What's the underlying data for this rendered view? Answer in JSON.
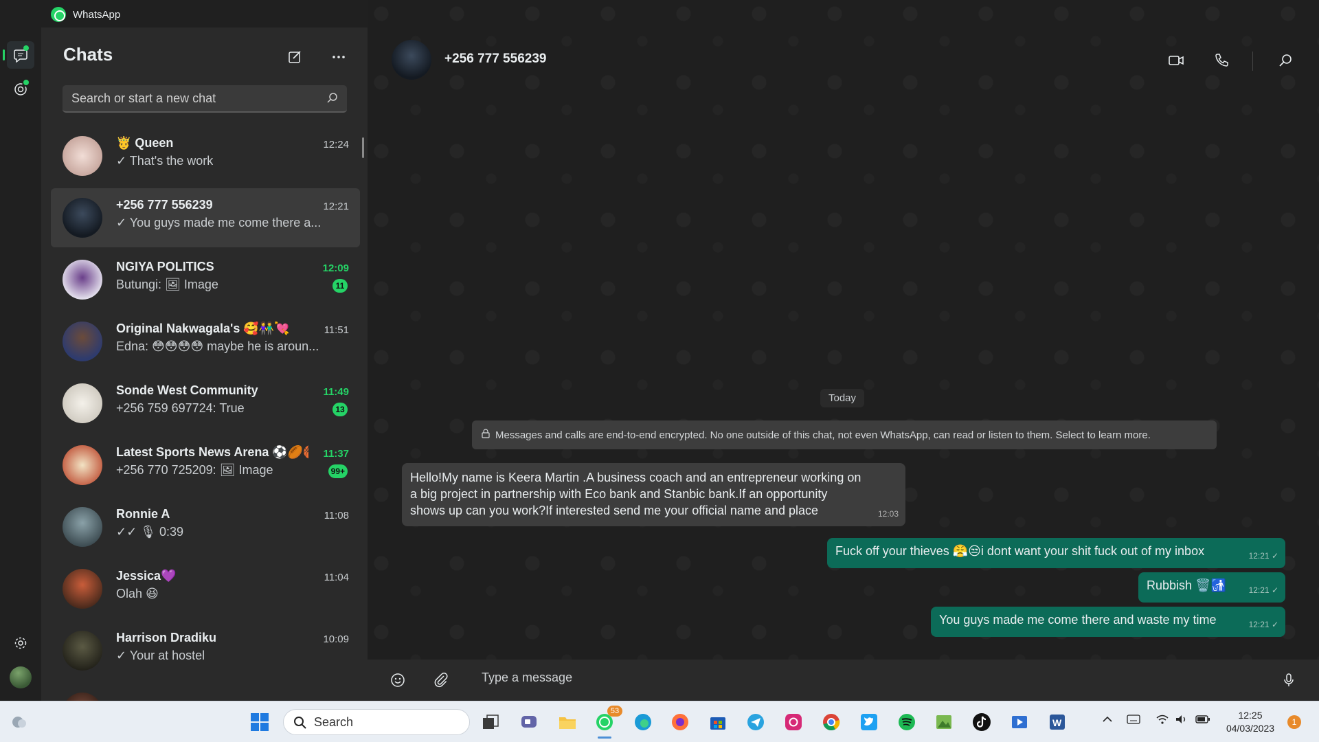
{
  "window": {
    "app_title": "WhatsApp"
  },
  "chatlist": {
    "title": "Chats",
    "search_placeholder": "Search or start a new chat",
    "items": [
      {
        "name": "🤴 Queen",
        "preview": "✓ That's the work",
        "time": "12:24",
        "badge": "",
        "selected": false
      },
      {
        "name": "+256 777 556239",
        "preview": "✓ You guys made me come there a...",
        "time": "12:21",
        "badge": "",
        "selected": true
      },
      {
        "name": "NGIYA POLITICS",
        "preview": "Butungi: 🖼 Image",
        "time": "12:09",
        "badge": "11",
        "selected": false
      },
      {
        "name": "Original Nakwagala's 🥰👫💘",
        "preview": "Edna: 😳😳😳😳 maybe he is aroun...",
        "time": "11:51",
        "badge": "",
        "selected": false
      },
      {
        "name": "Sonde West Community",
        "preview": "+256 759 697724: True",
        "time": "11:49",
        "badge": "13",
        "selected": false
      },
      {
        "name": "Latest Sports News Arena ⚽🏉🏀",
        "preview": "+256 770 725209: 🖼 Image",
        "time": "11:37",
        "badge": "99+",
        "selected": false
      },
      {
        "name": "Ronnie A",
        "preview": "✓✓ 🎙 0:39",
        "time": "11:08",
        "badge": "",
        "selected": false
      },
      {
        "name": "Jessica💜",
        "preview": "Olah 😆",
        "time": "11:04",
        "badge": "",
        "selected": false
      },
      {
        "name": "Harrison Dradiku",
        "preview": "✓ Your at hostel",
        "time": "10:09",
        "badge": "",
        "selected": false
      }
    ]
  },
  "conversation": {
    "contact": "+256 777 556239",
    "date_chip": "Today",
    "encryption_notice": "Messages and calls are end-to-end encrypted. No one outside of this chat, not even WhatsApp, can read or listen to them. Select to learn more.",
    "messages": [
      {
        "direction": "in",
        "text": "Hello!My name is Keera Martin .A business coach and an entrepreneur  working on a big project in partnership with Eco bank and Stanbic bank.If an opportunity shows up can you work?If interested send me your official name and place",
        "time": "12:03"
      },
      {
        "direction": "out",
        "text": "Fuck off your thieves 😤😒i dont want your shit fuck out of my inbox",
        "time": "12:21 ✓"
      },
      {
        "direction": "out",
        "text": "Rubbish 🗑️🚮",
        "time": "12:21 ✓"
      },
      {
        "direction": "out",
        "text": "You guys made me come there and waste my time",
        "time": "12:21 ✓"
      }
    ],
    "composer_placeholder": "Type a message"
  },
  "taskbar": {
    "search_label": "Search",
    "whatsapp_badge": "53",
    "clock_time": "12:25",
    "clock_date": "04/03/2023",
    "notification_count": "1"
  },
  "colors": {
    "accent_green": "#25d366",
    "outgoing_bubble": "#0c6b58",
    "incoming_bubble": "#3d3d3d"
  }
}
